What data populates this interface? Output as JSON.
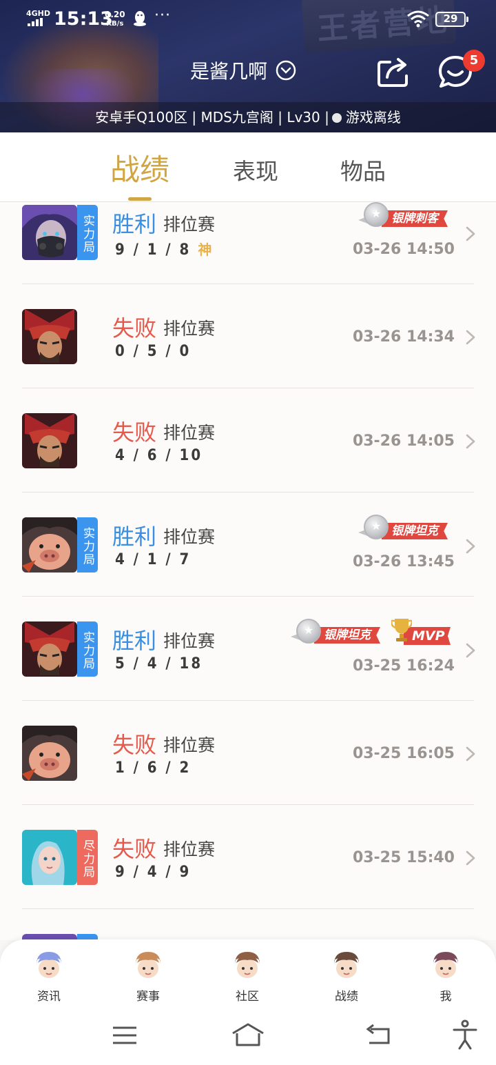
{
  "status_bar": {
    "network": "4GHD",
    "time": "15:13",
    "speed_value": "0.20",
    "speed_unit": "KB/s",
    "more": "···",
    "battery": "29"
  },
  "header": {
    "username": "是酱几啊",
    "server_info": "安卓手Q100区 | MDS九宫阁 | Lv30 |",
    "online_status": "游戏离线",
    "message_badge": "5",
    "background_sign": "王者营地"
  },
  "tabs": [
    {
      "label": "战绩",
      "active": true
    },
    {
      "label": "表现",
      "active": false
    },
    {
      "label": "物品",
      "active": false
    }
  ],
  "matches": [
    {
      "hero": "masked-assassin",
      "tag": "实力局",
      "tag_color": "blue",
      "result": "胜利",
      "win": true,
      "mode": "排位赛",
      "kda": "9 / 1 / 8",
      "god": "神",
      "medal": "银牌刺客",
      "mvp": "",
      "time": "03-26 14:50"
    },
    {
      "hero": "red-warrior",
      "tag": "",
      "tag_color": "",
      "result": "失败",
      "win": false,
      "mode": "排位赛",
      "kda": "0 / 5 / 0",
      "god": "",
      "medal": "",
      "mvp": "",
      "time": "03-26 14:34"
    },
    {
      "hero": "red-warrior",
      "tag": "",
      "tag_color": "",
      "result": "失败",
      "win": false,
      "mode": "排位赛",
      "kda": "4 / 6 / 10",
      "god": "",
      "medal": "",
      "mvp": "",
      "time": "03-26 14:05"
    },
    {
      "hero": "pig-tank",
      "tag": "实力局",
      "tag_color": "blue",
      "result": "胜利",
      "win": true,
      "mode": "排位赛",
      "kda": "4 / 1 / 7",
      "god": "",
      "medal": "银牌坦克",
      "mvp": "",
      "time": "03-26 13:45"
    },
    {
      "hero": "red-warrior",
      "tag": "实力局",
      "tag_color": "blue",
      "result": "胜利",
      "win": true,
      "mode": "排位赛",
      "kda": "5 / 4 / 18",
      "god": "",
      "medal": "银牌坦克",
      "mvp": "MVP",
      "time": "03-25 16:24"
    },
    {
      "hero": "pig-tank",
      "tag": "",
      "tag_color": "",
      "result": "失败",
      "win": false,
      "mode": "排位赛",
      "kda": "1 / 6 / 2",
      "god": "",
      "medal": "",
      "mvp": "",
      "time": "03-25 16:05"
    },
    {
      "hero": "teal-mage",
      "tag": "尽力局",
      "tag_color": "red",
      "result": "失败",
      "win": false,
      "mode": "排位赛",
      "kda": "9 / 4 / 9",
      "god": "",
      "medal": "",
      "mvp": "",
      "time": "03-25 15:40"
    }
  ],
  "bottom_nav": [
    {
      "label": "资讯",
      "icon": "news-character-icon",
      "color": "#8a9be6"
    },
    {
      "label": "赛事",
      "icon": "events-character-icon",
      "color": "#c98b5a"
    },
    {
      "label": "社区",
      "icon": "community-character-icon",
      "color": "#8e5f45"
    },
    {
      "label": "战绩",
      "icon": "records-character-icon",
      "color": "#6a4a3a"
    },
    {
      "label": "我",
      "icon": "me-character-icon",
      "color": "#7a4a5a"
    }
  ],
  "colors": {
    "accent": "#d0a545",
    "win": "#3b8fe0",
    "lose": "#e55a4c",
    "badge": "#ee3b30"
  }
}
